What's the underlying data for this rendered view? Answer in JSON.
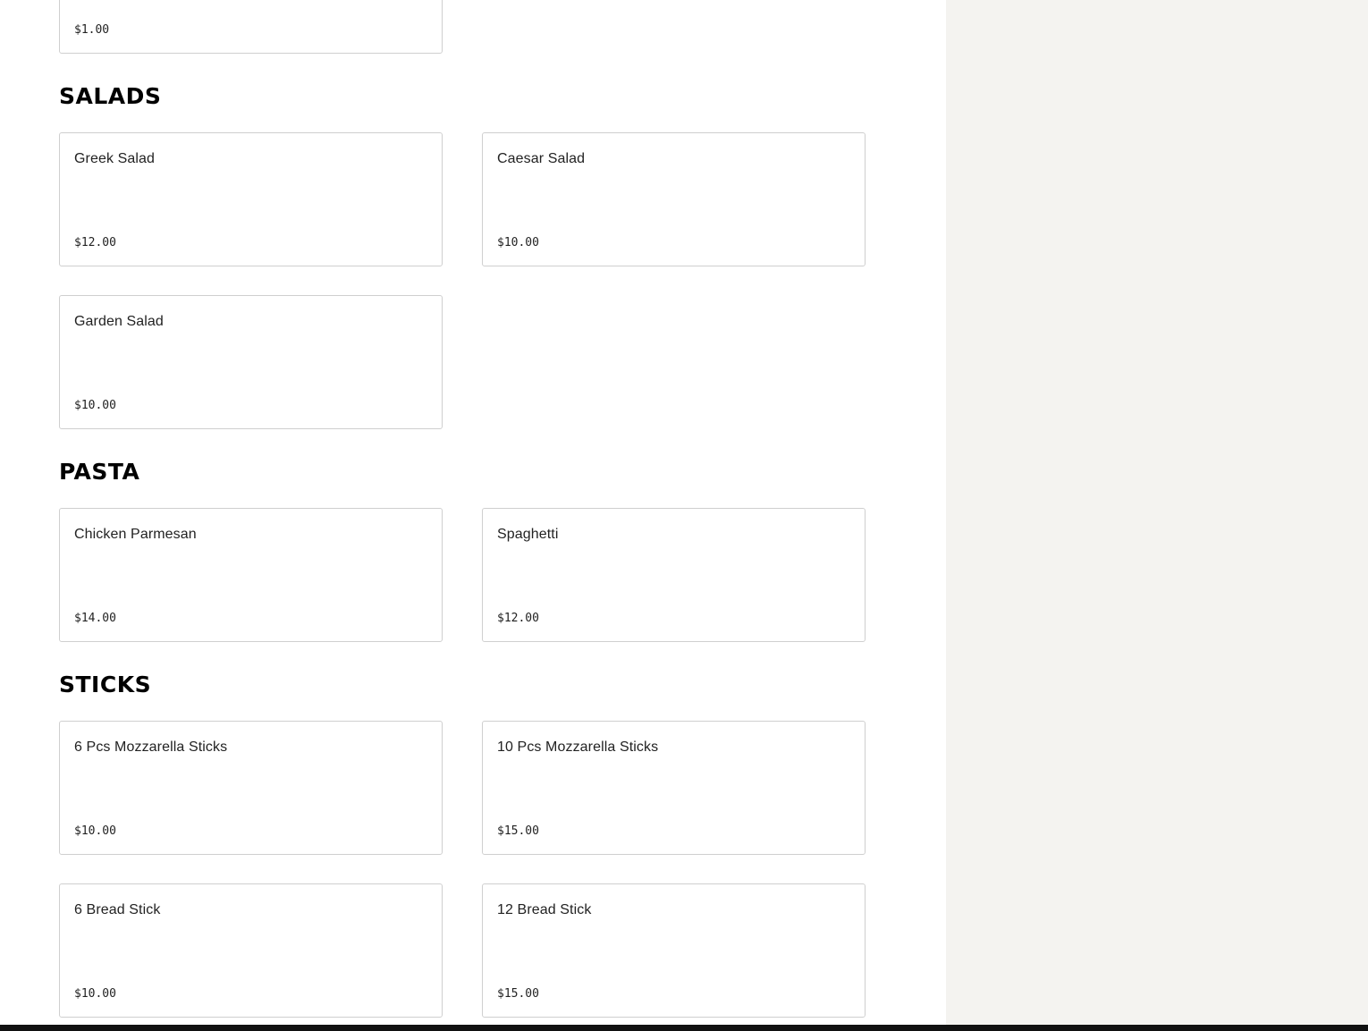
{
  "previous_item": {
    "price": "$1.00"
  },
  "sections": [
    {
      "title": "SALADS",
      "items": [
        {
          "name": "Greek Salad",
          "price": "$12.00"
        },
        {
          "name": "Caesar Salad",
          "price": "$10.00"
        },
        {
          "name": "Garden Salad",
          "price": "$10.00"
        }
      ]
    },
    {
      "title": "PASTA",
      "items": [
        {
          "name": "Chicken Parmesan",
          "price": "$14.00"
        },
        {
          "name": "Spaghetti",
          "price": "$12.00"
        }
      ]
    },
    {
      "title": "STICKS",
      "items": [
        {
          "name": "6 Pcs Mozzarella Sticks",
          "price": "$10.00"
        },
        {
          "name": "10 Pcs Mozzarella Sticks",
          "price": "$15.00"
        },
        {
          "name": "6 Bread Stick",
          "price": "$10.00"
        },
        {
          "name": "12 Bread Stick",
          "price": "$15.00"
        }
      ]
    }
  ]
}
